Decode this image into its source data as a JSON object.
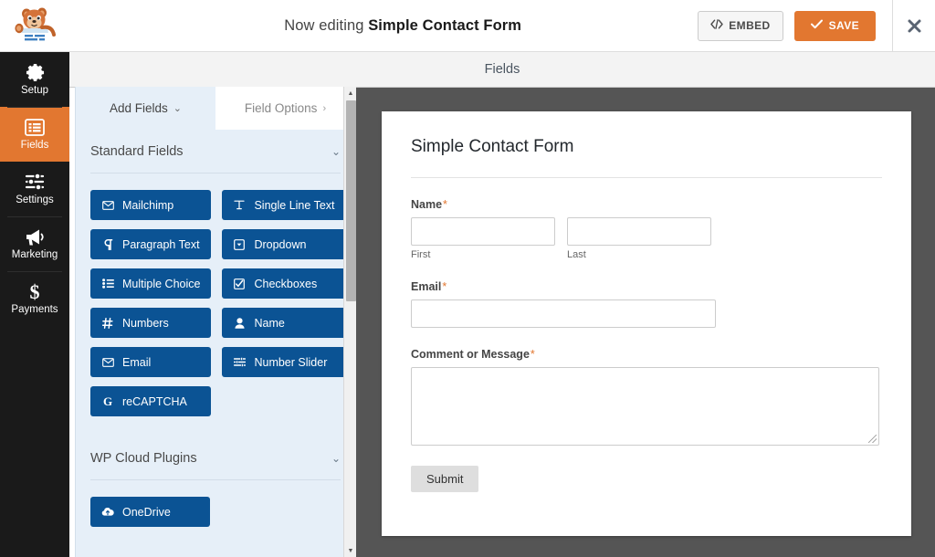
{
  "topbar": {
    "mascot_icon": "wpforms-bear-mascot-icon",
    "editing_prefix": "Now editing ",
    "form_name": "Simple Contact Form",
    "embed_label": "EMBED",
    "embed_icon": "code-embed-icon",
    "save_label": "SAVE",
    "save_icon": "checkmark-icon",
    "close_icon": "close-icon",
    "accent_orange": "#e27730"
  },
  "rail": {
    "items": [
      {
        "label": "Setup",
        "icon": "gear-icon",
        "active": false
      },
      {
        "label": "Fields",
        "icon": "list-rows-icon",
        "active": true
      },
      {
        "label": "Settings",
        "icon": "sliders-icon",
        "active": false
      },
      {
        "label": "Marketing",
        "icon": "megaphone-icon",
        "active": false
      },
      {
        "label": "Payments",
        "icon": "dollar-icon",
        "active": false
      }
    ]
  },
  "panel": {
    "tabs": [
      {
        "label": "Add Fields",
        "chevron": "⌄",
        "active": true
      },
      {
        "label": "Field Options",
        "chevron": "›",
        "active": false
      }
    ],
    "sections": [
      {
        "title": "Standard Fields",
        "chevron": "⌄",
        "fields": [
          {
            "label": "Mailchimp",
            "icon": "envelope-icon"
          },
          {
            "label": "Single Line Text",
            "icon": "text-cursor-icon"
          },
          {
            "label": "Paragraph Text",
            "icon": "pilcrow-icon"
          },
          {
            "label": "Dropdown",
            "icon": "dropdown-caret-box-icon"
          },
          {
            "label": "Multiple Choice",
            "icon": "radio-list-icon"
          },
          {
            "label": "Checkboxes",
            "icon": "checkbox-checked-icon"
          },
          {
            "label": "Numbers",
            "icon": "hash-icon"
          },
          {
            "label": "Name",
            "icon": "user-icon"
          },
          {
            "label": "Email",
            "icon": "envelope-icon"
          },
          {
            "label": "Number Slider",
            "icon": "slider-icon"
          },
          {
            "label": "reCAPTCHA",
            "icon": "google-g-icon"
          }
        ]
      },
      {
        "title": "WP Cloud Plugins",
        "chevron": "⌄",
        "fields": [
          {
            "label": "OneDrive",
            "icon": "cloud-upload-icon"
          }
        ]
      }
    ],
    "field_button_color": "#0b5394",
    "background_color": "#e6eff8",
    "scrollbar": {
      "up_arrow": "▲",
      "down_arrow": "▼"
    }
  },
  "main": {
    "fields_bar_label": "Fields",
    "preview_background": "#555555",
    "form": {
      "title": "Simple Contact Form",
      "required_mark": "*",
      "fields": [
        {
          "label": "Name",
          "required": true,
          "type": "name-split",
          "sublabels": [
            "First",
            "Last"
          ]
        },
        {
          "label": "Email",
          "required": true,
          "type": "text"
        },
        {
          "label": "Comment or Message",
          "required": true,
          "type": "textarea"
        }
      ],
      "submit_label": "Submit"
    }
  }
}
